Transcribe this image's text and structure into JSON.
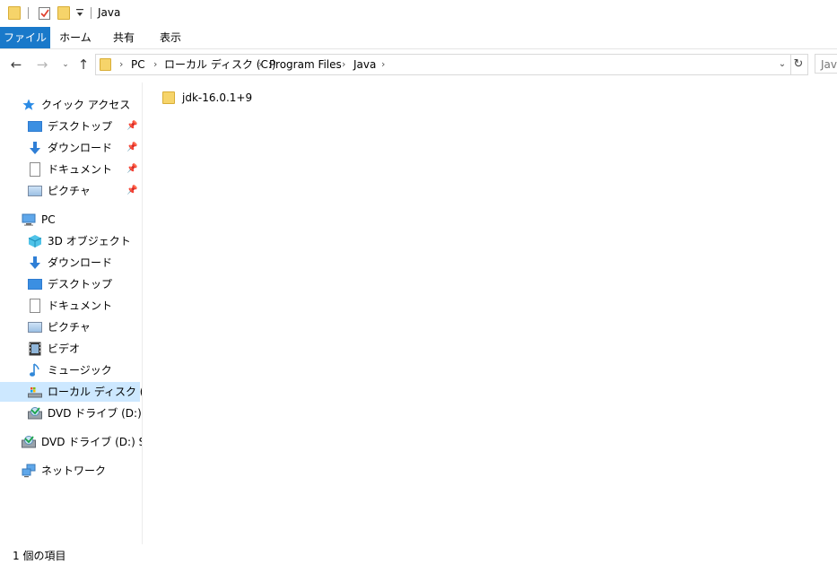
{
  "window": {
    "title": "Java"
  },
  "ribbon": {
    "tabs": [
      {
        "label": "ファイル",
        "active": true
      },
      {
        "label": "ホーム"
      },
      {
        "label": "共有"
      },
      {
        "label": "表示"
      }
    ],
    "accent": "#1979ca"
  },
  "address": {
    "crumbs": [
      "PC",
      "ローカル ディスク (C:)",
      "Program Files",
      "Java"
    ],
    "search_placeholder": "Java"
  },
  "nav": {
    "quick_access": {
      "label": "クイック アクセス",
      "items": [
        {
          "label": "デスクトップ",
          "icon": "desktop-icon",
          "pinned": true
        },
        {
          "label": "ダウンロード",
          "icon": "download-icon",
          "pinned": true
        },
        {
          "label": "ドキュメント",
          "icon": "document-icon",
          "pinned": true
        },
        {
          "label": "ピクチャ",
          "icon": "picture-icon",
          "pinned": true
        }
      ]
    },
    "pc": {
      "label": "PC",
      "items": [
        {
          "label": "3D オブジェクト",
          "icon": "3d-objects-icon"
        },
        {
          "label": "ダウンロード",
          "icon": "download-icon"
        },
        {
          "label": "デスクトップ",
          "icon": "desktop-icon"
        },
        {
          "label": "ドキュメント",
          "icon": "document-icon"
        },
        {
          "label": "ピクチャ",
          "icon": "picture-icon"
        },
        {
          "label": "ビデオ",
          "icon": "video-icon"
        },
        {
          "label": "ミュージック",
          "icon": "music-icon"
        },
        {
          "label": "ローカル ディスク (C:)",
          "icon": "local-disk-icon",
          "selected": true
        },
        {
          "label": "DVD ドライブ (D:) SSS",
          "icon": "dvd-drive-icon"
        }
      ]
    },
    "dvd": {
      "label": "DVD ドライブ (D:) SSS_X"
    },
    "network": {
      "label": "ネットワーク"
    }
  },
  "content": {
    "items": [
      {
        "name": "jdk-16.0.1+9",
        "icon": "folder-icon"
      }
    ]
  },
  "status": {
    "text": "1 個の項目"
  },
  "colors": {
    "selection": "#cde8ff",
    "folder": "#f6d46a"
  }
}
